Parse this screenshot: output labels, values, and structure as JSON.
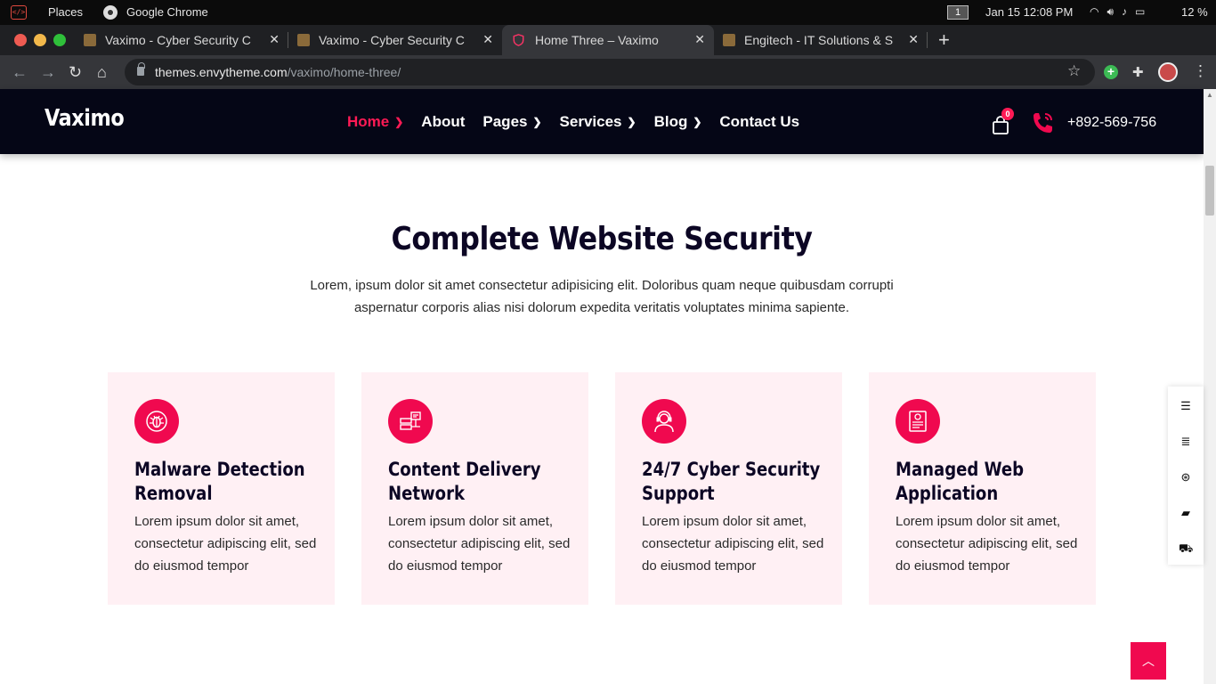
{
  "os": {
    "places": "Places",
    "app": "Google Chrome",
    "workspace": "1",
    "clock": "Jan 15  12:08 PM",
    "battery": "12 %"
  },
  "tabs": [
    {
      "title": "Vaximo - Cyber Security C"
    },
    {
      "title": "Vaximo - Cyber Security C"
    },
    {
      "title": "Home Three – Vaximo"
    },
    {
      "title": "Engitech - IT Solutions & S"
    }
  ],
  "address": {
    "host": "themes.envytheme.com",
    "path": "/vaximo/home-three/"
  },
  "site": {
    "logo": "Vaximo",
    "nav": [
      {
        "label": "Home",
        "has_chevron": true
      },
      {
        "label": "About",
        "has_chevron": false
      },
      {
        "label": "Pages",
        "has_chevron": true
      },
      {
        "label": "Services",
        "has_chevron": true
      },
      {
        "label": "Blog",
        "has_chevron": true
      },
      {
        "label": "Contact Us",
        "has_chevron": false
      }
    ],
    "cart_count": "0",
    "phone": "+892-569-756",
    "accent": "#f0094f"
  },
  "section": {
    "title": "Complete Website Security",
    "description": "Lorem, ipsum dolor sit amet consectetur adipisicing elit. Doloribus quam neque quibusdam corrupti aspernatur corporis alias nisi dolorum expedita veritatis voluptates minima sapiente."
  },
  "cards": [
    {
      "icon": "bug-icon",
      "title": "Malware Detection Removal",
      "text": "Lorem ipsum dolor sit amet, consectetur adipiscing elit, sed do eiusmod tempor"
    },
    {
      "icon": "server-icon",
      "title": "Content Delivery Network",
      "text": "Lorem ipsum dolor sit amet, consectetur adipiscing elit, sed do eiusmod tempor"
    },
    {
      "icon": "support-agent-icon",
      "title": "24/7 Cyber Security Support",
      "text": "Lorem ipsum dolor sit amet, consectetur adipiscing elit, sed do eiusmod tempor"
    },
    {
      "icon": "web-app-icon",
      "title": "Managed Web Application",
      "text": "Lorem ipsum dolor sit amet, consectetur adipiscing elit, sed do eiusmod tempor"
    }
  ],
  "side_tools": [
    "align-left-icon",
    "list-icon",
    "lifebuoy-icon",
    "book-icon",
    "cart-icon"
  ]
}
